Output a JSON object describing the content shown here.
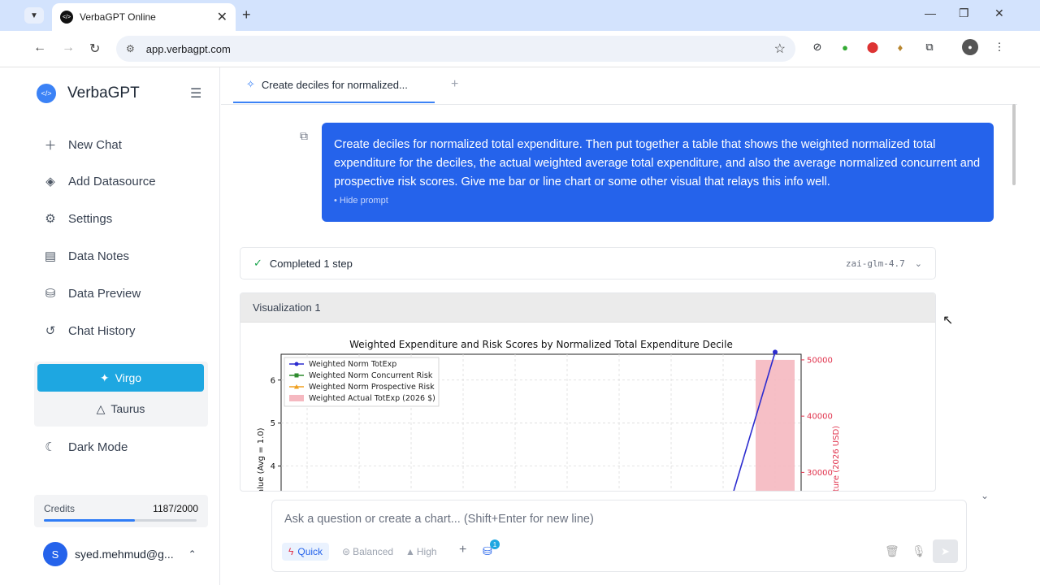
{
  "browser": {
    "tab_title": "VerbaGPT Online",
    "url": "app.verbagpt.com"
  },
  "sidebar": {
    "brand": "VerbaGPT",
    "nav": [
      {
        "label": "New Chat",
        "icon": "plus-icon"
      },
      {
        "label": "Add Datasource",
        "icon": "layers-icon"
      },
      {
        "label": "Settings",
        "icon": "gear-icon"
      },
      {
        "label": "Data Notes",
        "icon": "document-icon"
      },
      {
        "label": "Data Preview",
        "icon": "database-icon"
      },
      {
        "label": "Chat History",
        "icon": "history-icon"
      }
    ],
    "models": {
      "active": "Virgo",
      "other": "Taurus"
    },
    "dark_mode": "Dark Mode",
    "credits": {
      "label": "Credits",
      "value": "1187/2000",
      "used_fraction": 0.5935
    },
    "user": {
      "initial": "S",
      "email": "syed.mehmud@g..."
    }
  },
  "main": {
    "tab_label": "Create deciles for normalized...",
    "prompt": "Create deciles for normalized total expenditure. Then put together a table that shows the weighted normalized total expenditure for the deciles, the actual weighted average total expenditure, and also the average normalized concurrent and prospective risk scores. Give me bar or line chart or some other visual that relays this info well.",
    "hide_prompt": "Hide prompt",
    "step": {
      "label": "Completed 1 step",
      "model": "zai-glm-4.7"
    },
    "viz_title": "Visualization 1"
  },
  "chart_data": {
    "type": "bar",
    "title": "Weighted Expenditure and Risk Scores by Normalized Total Expenditure Decile",
    "ylabel_left": "alue (Avg = 1.0)",
    "ylabel_right": "iture (2026 USD)",
    "left_ticks": [
      "4",
      "5",
      "6"
    ],
    "right_ticks": [
      "30000",
      "40000",
      "50000"
    ],
    "ylim_left": [
      3.2,
      6.6
    ],
    "ylim_right": [
      25000,
      51000
    ],
    "legend": [
      "Weighted Norm TotExp",
      "Weighted Norm Concurrent Risk",
      "Weighted Norm Prospective Risk",
      "Weighted Actual TotExp (2026 $)"
    ],
    "legend_position": "top-left",
    "grid": true,
    "bars": [
      {
        "name": "Weighted Actual TotExp (2026 $)",
        "decile": 10,
        "value": 50000
      }
    ],
    "line": {
      "name": "Weighted Norm TotExp",
      "points": [
        {
          "decile": 9.1,
          "value": 3.0
        },
        {
          "decile": 10,
          "value": 6.65
        }
      ]
    },
    "colors": {
      "line": "#2c2ccf",
      "bar": "#f5b8c0",
      "right_axis": "#e0314b"
    }
  },
  "composer": {
    "placeholder": "Ask a question or create a chart... (Shift+Enter for new line)",
    "modes": [
      "Quick",
      "Balanced",
      "High"
    ],
    "datasource_count": "1"
  }
}
